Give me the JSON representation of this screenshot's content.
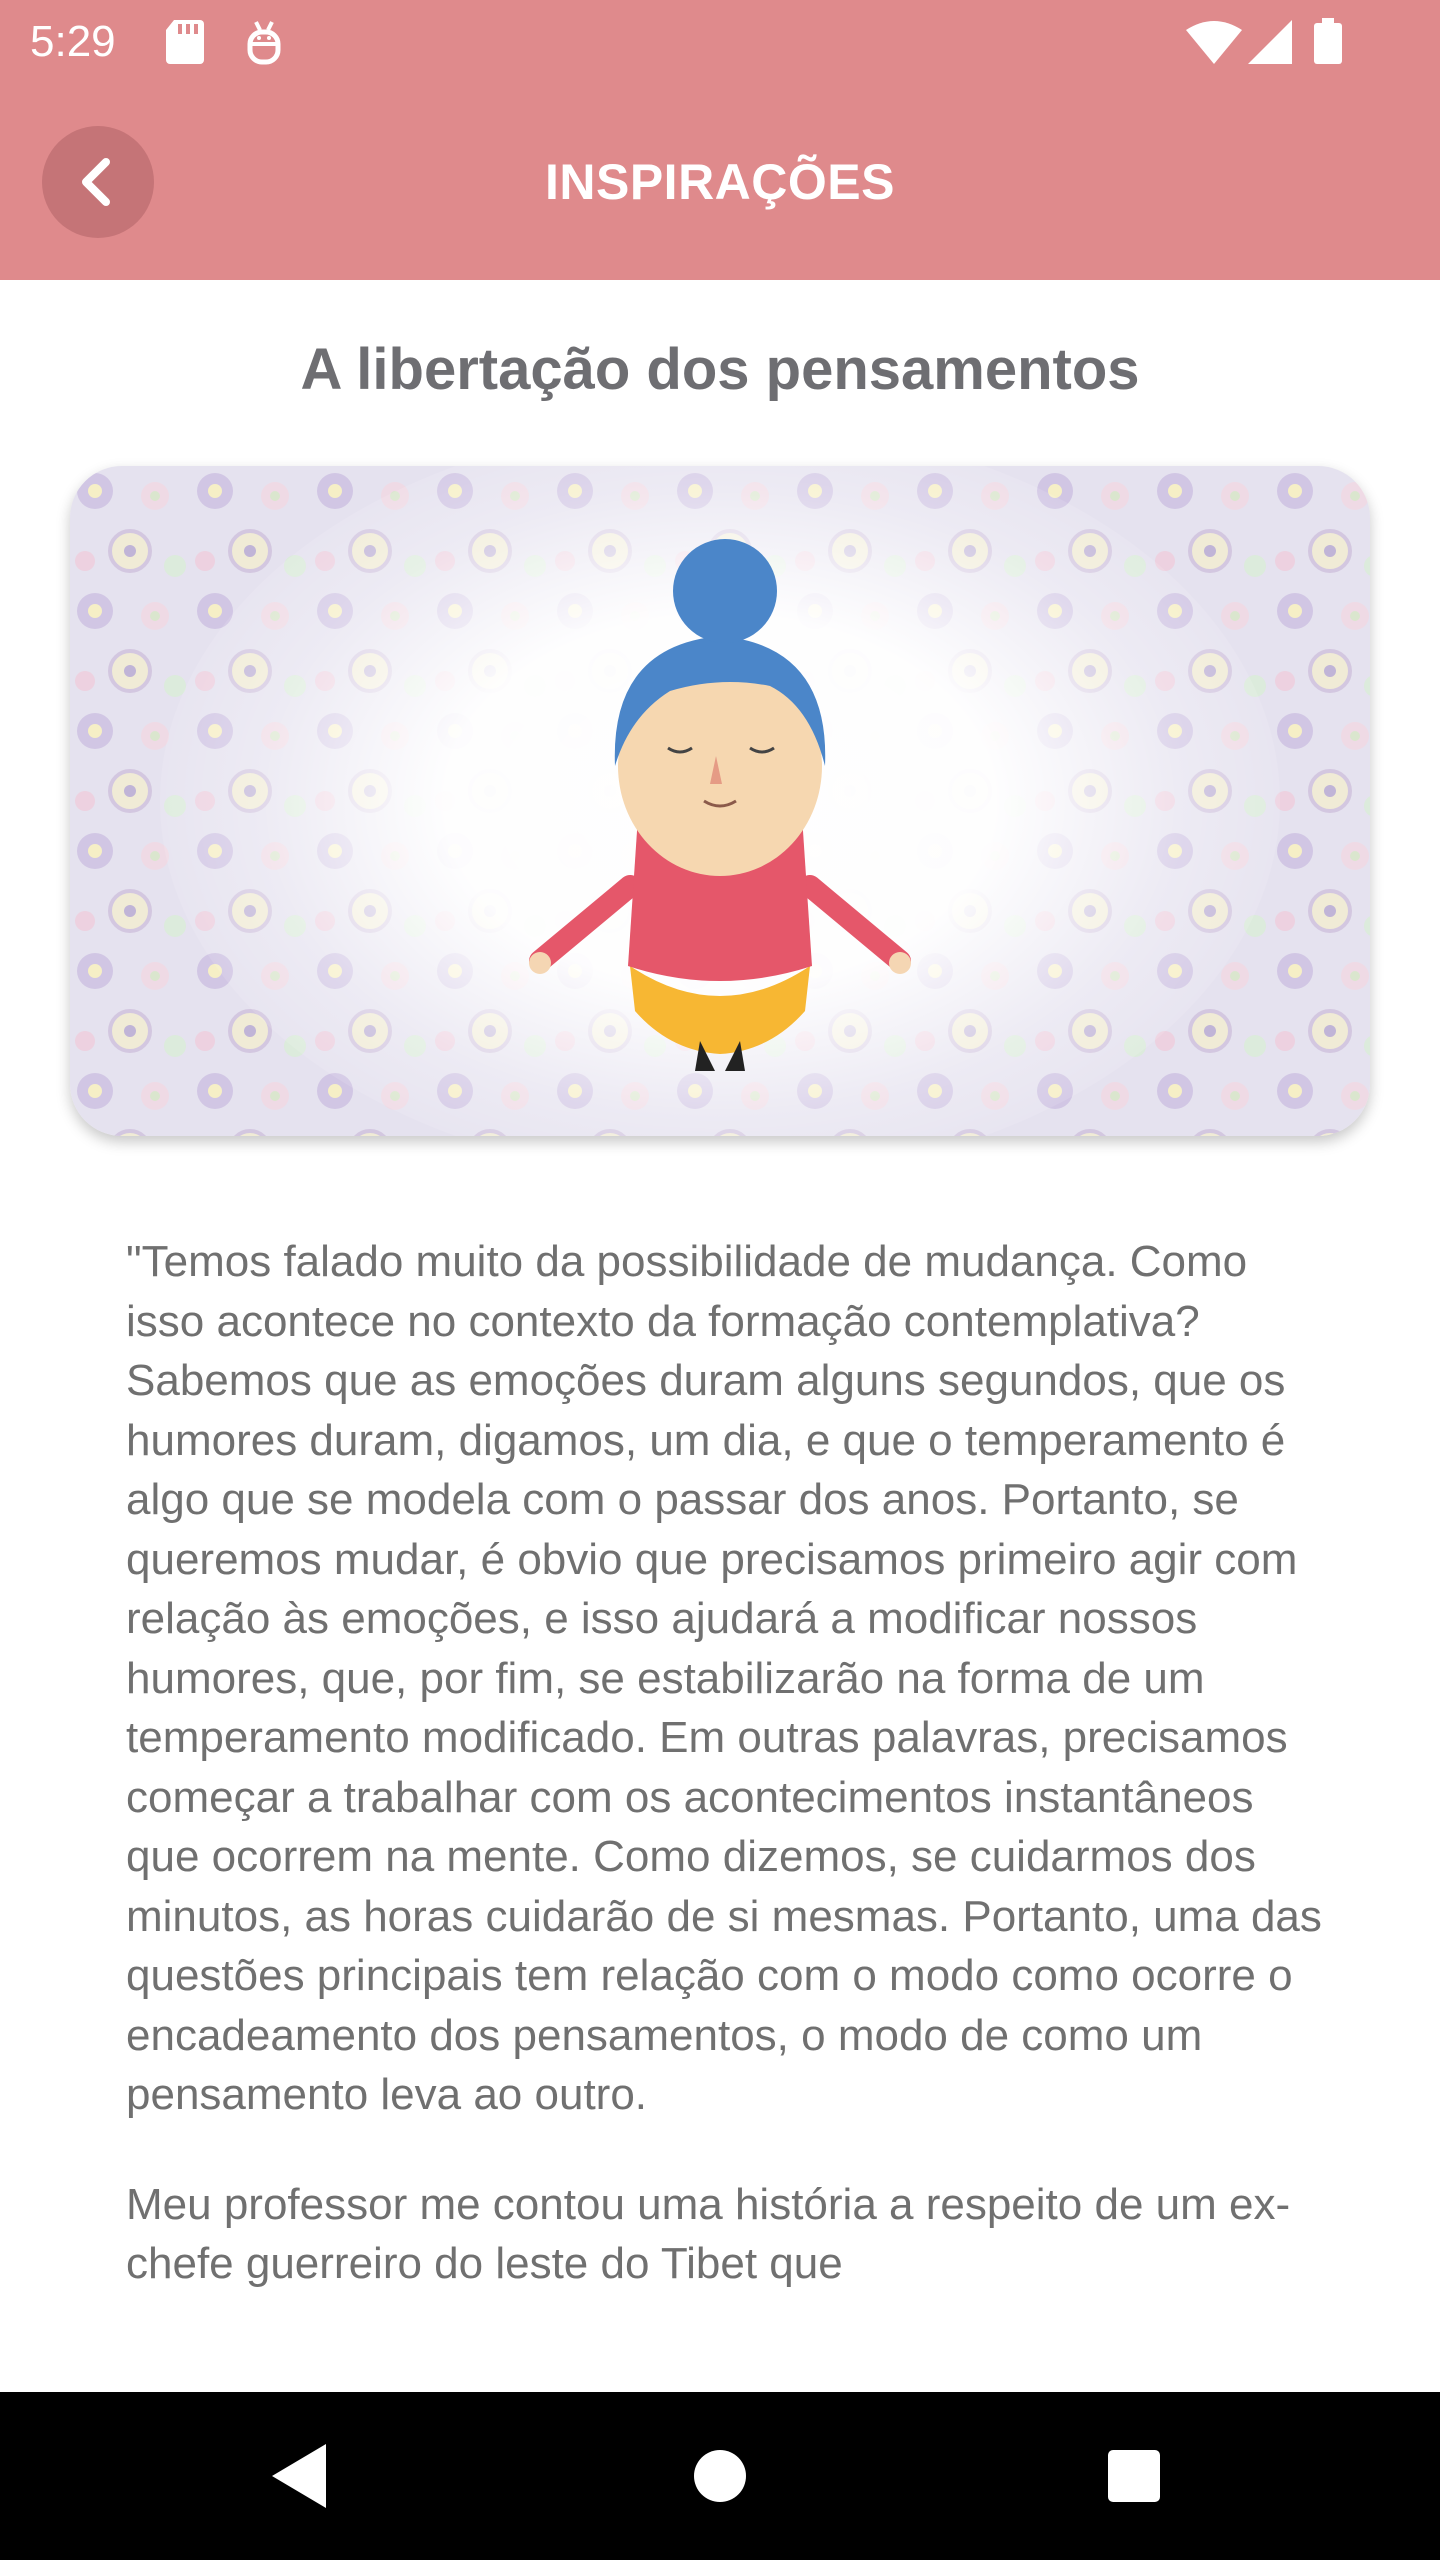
{
  "status_bar": {
    "time": "5:29",
    "icons": [
      "sd-card-icon",
      "android-icon",
      "wifi-icon",
      "signal-icon",
      "battery-icon"
    ]
  },
  "app_bar": {
    "title": "INSPIRAÇÕES",
    "back_icon": "chevron-left-icon",
    "color": "#df8a8c"
  },
  "article": {
    "title": "A libertação dos pensamentos",
    "paragraphs": [
      "\"Temos falado muito da possibilidade de mudança. Como isso acontece no contexto da formação contemplativa? Sabemos que as emoções duram alguns segundos, que os humores duram, digamos, um dia, e que o temperamento é algo que se modela com o passar dos anos. Portanto, se queremos mudar, é obvio que precisamos primeiro agir com relação às emoções, e isso ajudará a modificar nossos humores, que, por fim, se estabilizarão na forma de um temperamento modificado. Em outras palavras, precisamos começar a trabalhar com os acontecimentos instantâneos que ocorrem na mente. Como dizemos, se cuidarmos dos minutos, as horas cuidarão de si mesmas. Portanto, uma das questões principais tem relação com o modo como ocorre o encadeamento dos pensamentos, o modo de como um pensamento leva ao outro.",
      "Meu professor me contou uma história a respeito de um ex-chefe guerreiro do leste do Tibet que"
    ]
  },
  "nav_bar": {
    "buttons": [
      "back-triangle-icon",
      "home-circle-icon",
      "recents-square-icon"
    ]
  }
}
